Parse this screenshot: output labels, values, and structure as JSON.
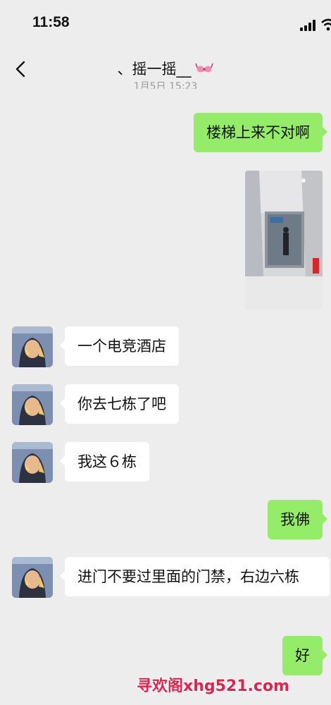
{
  "status_bar": {
    "time": "11:58"
  },
  "nav": {
    "title": "、摇一摇__",
    "title_icon": "bra-icon"
  },
  "timestamp": "1月5日 15:23",
  "messages": [
    {
      "side": "right",
      "type": "text",
      "text": "楼梯上来不对啊"
    },
    {
      "side": "right",
      "type": "image",
      "icon": "photo-hallway"
    },
    {
      "side": "left",
      "type": "text",
      "text": "一个电竞酒店"
    },
    {
      "side": "left",
      "type": "text",
      "text": "你去七栋了吧"
    },
    {
      "side": "left",
      "type": "text",
      "text": "我这６栋"
    },
    {
      "side": "right",
      "type": "text",
      "text": "我佛"
    },
    {
      "side": "left",
      "type": "text",
      "text": "进门不要过里面的门禁，右边六栋"
    },
    {
      "side": "right",
      "type": "text",
      "text": "好"
    }
  ],
  "watermark": "寻欢阁xhg521.com",
  "colors": {
    "background": "#ededed",
    "outgoing_bubble": "#95ec69",
    "incoming_bubble": "#ffffff",
    "watermark": "#e6204a"
  }
}
